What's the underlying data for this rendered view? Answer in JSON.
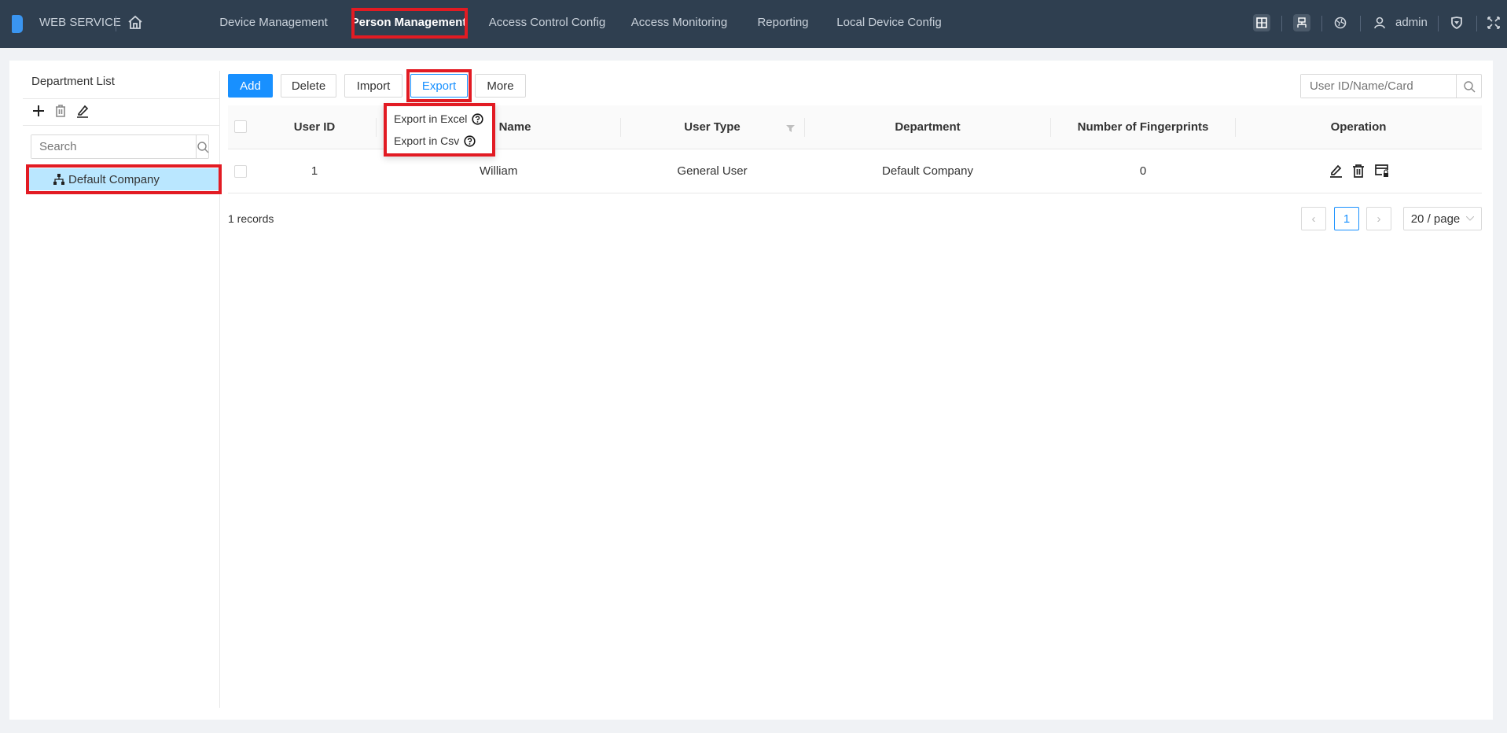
{
  "header": {
    "app_title": "WEB SERVICE",
    "nav": [
      {
        "label": "Device Management"
      },
      {
        "label": "Person Management",
        "active": true
      },
      {
        "label": "Access Control Config"
      },
      {
        "label": "Access Monitoring"
      },
      {
        "label": "Reporting"
      },
      {
        "label": "Local Device Config"
      }
    ],
    "username": "admin"
  },
  "sidebar": {
    "title": "Department List",
    "search_placeholder": "Search",
    "tree": [
      {
        "label": "Default Company",
        "selected": true
      }
    ]
  },
  "toolbar": {
    "add": "Add",
    "delete": "Delete",
    "import": "Import",
    "export": "Export",
    "more": "More",
    "search_placeholder": "User ID/Name/Card"
  },
  "export_menu": {
    "items": [
      {
        "label": "Export in Excel"
      },
      {
        "label": "Export in Csv"
      }
    ]
  },
  "table": {
    "columns": [
      "User ID",
      "Name",
      "User Type",
      "Department",
      "Number of Fingerprints",
      "Operation"
    ],
    "rows": [
      {
        "user_id": "1",
        "name": "William",
        "user_type": "General User",
        "department": "Default Company",
        "fingerprints": "0"
      }
    ]
  },
  "footer": {
    "records": "1 records",
    "current_page": "1",
    "page_size": "20 / page"
  },
  "colors": {
    "topbar": "#2f3f50",
    "accent": "#1890ff",
    "highlight": "#e21b23",
    "selected_row": "#bae7ff"
  }
}
